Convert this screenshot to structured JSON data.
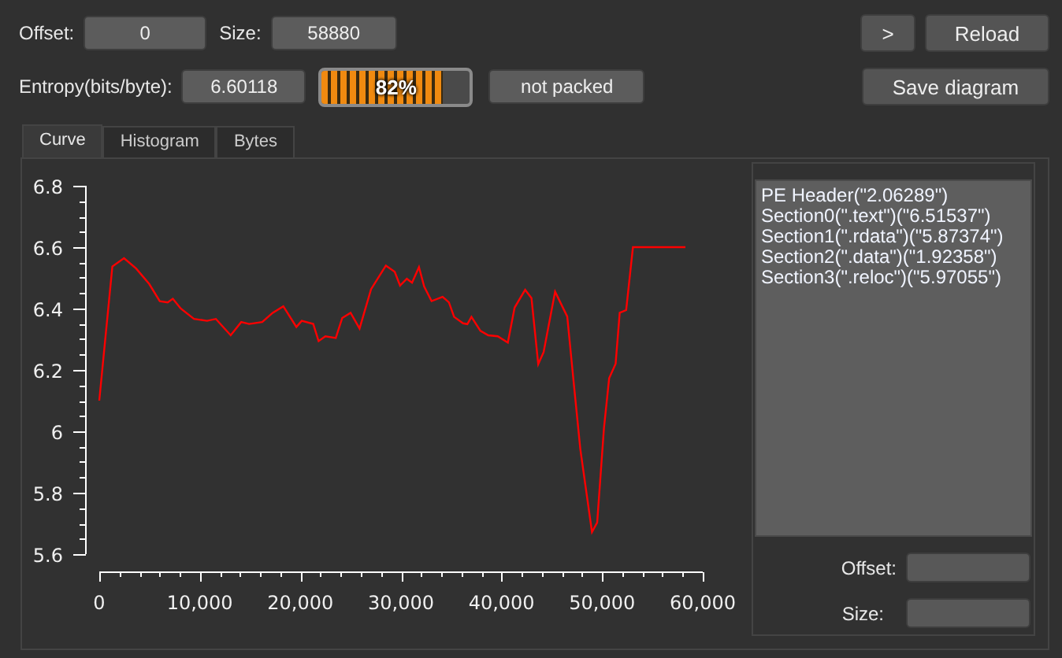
{
  "top_bar": {
    "offset_label": "Offset:",
    "offset_value": "0",
    "size_label": "Size:",
    "size_value": "58880",
    "entropy_label": "Entropy(bits/byte):",
    "entropy_value": "6.60118",
    "progress": {
      "level": 0.82,
      "text": "82%"
    },
    "status": "not packed",
    "buttons": [
      {
        "label": ">"
      },
      {
        "label": "Reload"
      },
      {
        "label": "Save diagram"
      }
    ]
  },
  "tabs": [
    {
      "label": "Curve",
      "selected": true
    },
    {
      "label": "Histogram",
      "selected": false
    },
    {
      "label": "Bytes",
      "selected": false
    }
  ],
  "chart": {
    "chart_data": {
      "type": "line",
      "xlim": [
        0,
        60000
      ],
      "ylim": [
        5.6,
        6.8
      ],
      "xticks": [
        {
          "value": 0,
          "label": "0"
        },
        {
          "value": 10000,
          "label": "10,000"
        },
        {
          "value": 20000,
          "label": "20,000"
        },
        {
          "value": 30000,
          "label": "30,000"
        },
        {
          "value": 40000,
          "label": "40,000"
        },
        {
          "value": 50000,
          "label": "50,000"
        },
        {
          "value": 60000,
          "label": "60,000"
        }
      ],
      "yticks": [
        5.6,
        5.8,
        6,
        6.2,
        6.4,
        6.6,
        6.8
      ],
      "x": [
        0,
        1300,
        2460,
        3660,
        4970,
        6010,
        6800,
        7320,
        8100,
        9410,
        10720,
        11600,
        13070,
        14110,
        14900,
        16200,
        17250,
        18300,
        19600,
        20130,
        21270,
        21800,
        22480,
        23520,
        24150,
        24990,
        25880,
        27030,
        28490,
        29380,
        29900,
        30580,
        31100,
        31780,
        32310,
        33040,
        34140,
        34760,
        35280,
        36170,
        36590,
        37010,
        37900,
        38680,
        39620,
        40620,
        41300,
        42340,
        42970,
        43650,
        44170,
        45320,
        46520,
        47150,
        47830,
        48980,
        49500,
        50180,
        50700,
        51330,
        51750,
        52380,
        53060,
        58280
      ],
      "series": [
        {
          "color": "#ff0000",
          "values": [
            6.1,
            6.537,
            6.564,
            6.53,
            6.48,
            6.424,
            6.42,
            6.432,
            6.4,
            6.366,
            6.36,
            6.366,
            6.313,
            6.356,
            6.35,
            6.356,
            6.386,
            6.407,
            6.34,
            6.36,
            6.35,
            6.294,
            6.31,
            6.304,
            6.369,
            6.386,
            6.335,
            6.463,
            6.54,
            6.52,
            6.475,
            6.497,
            6.484,
            6.535,
            6.472,
            6.424,
            6.438,
            6.42,
            6.373,
            6.352,
            6.349,
            6.373,
            6.327,
            6.313,
            6.31,
            6.289,
            6.403,
            6.461,
            6.434,
            6.219,
            6.258,
            6.455,
            6.374,
            6.164,
            5.942,
            5.672,
            5.703,
            6.01,
            6.173,
            6.22,
            6.386,
            6.395,
            6.6,
            6.6
          ]
        }
      ]
    }
  },
  "sections": [
    "PE Header(\"2.06289\")",
    "Section0(\".text\")(\"6.51537\")",
    "Section1(\".rdata\")(\"5.87374\")",
    "Section2(\".data\")(\"1.92358\")",
    "Section3(\".reloc\")(\"5.97055\")"
  ],
  "details": {
    "offset_label": "Offset:",
    "size_label": "Size:"
  }
}
